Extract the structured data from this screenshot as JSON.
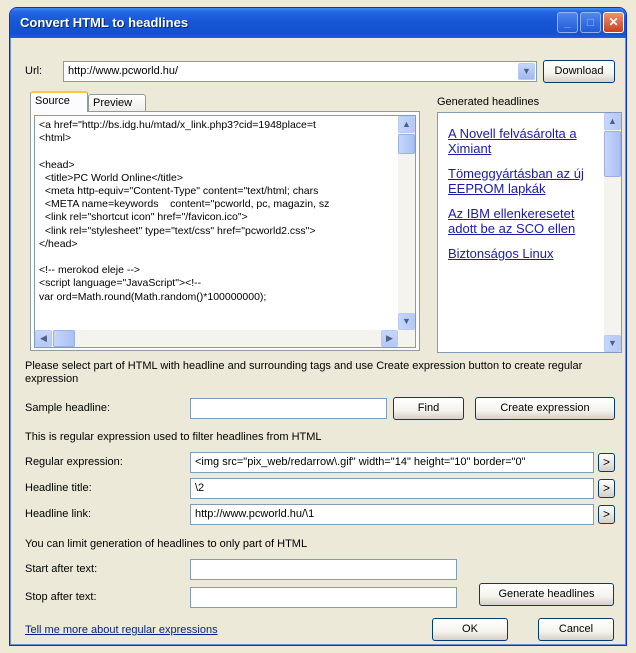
{
  "window": {
    "title": "Convert HTML to headlines"
  },
  "url": {
    "label": "Url:",
    "value": "http://www.pcworld.hu/",
    "download_label": "Download"
  },
  "tabs": [
    {
      "label": "Source"
    },
    {
      "label": "Preview"
    }
  ],
  "source_lines": [
    "<a href=\"http://bs.idg.hu/mtad/x_link.php3?cid=1948place=t",
    "<html>",
    "",
    "<head>",
    "  <title>PC World Online</title>",
    "  <meta http-equiv=\"Content-Type\" content=\"text/html; chars",
    "  <META name=keywords    content=\"pcworld, pc, magazin, sz",
    "  <link rel=\"shortcut icon\" href=\"/favicon.ico\">",
    "  <link rel=\"stylesheet\" type=\"text/css\" href=\"pcworld2.css\">",
    "</head>",
    "",
    "<!-- merokod eleje -->",
    "<script language=\"JavaScript\"><!--",
    "var ord=Math.round(Math.random()*100000000);"
  ],
  "generated": {
    "label": "Generated headlines",
    "headlines": [
      "A Novell felvásárolta a Ximiant",
      "Tömeggyártásban az új EEPROM lapkák",
      "Az IBM ellenkeresetet adott be az SCO ellen",
      "Biztonságos Linux"
    ]
  },
  "instruction": "Please select part of HTML with headline and surrounding tags and use Create expression button to create regular expression",
  "sample": {
    "label": "Sample headline:",
    "value": "",
    "find_label": "Find",
    "create_label": "Create expression"
  },
  "regex_info": "This is regular expression used to filter headlines from HTML",
  "regex": {
    "label": "Regular expression:",
    "value": "<img src=\"pix_web/redarrow\\.gif\" width=\"14\" height=\"10\" border=\"0\""
  },
  "headline_title": {
    "label": "Headline title:",
    "value": "\\2"
  },
  "headline_link": {
    "label": "Headline link:",
    "value": "http://www.pcworld.hu/\\1"
  },
  "limit_info": "You can limit generation of headlines to only part of HTML",
  "start_after": {
    "label": "Start after text:",
    "value": ""
  },
  "stop_after": {
    "label": "Stop after text:",
    "value": ""
  },
  "generate_label": "Generate headlines",
  "tell_more": "Tell me more about regular expressions",
  "ok_label": "OK",
  "cancel_label": "Cancel",
  "arrow_glyph": ">"
}
